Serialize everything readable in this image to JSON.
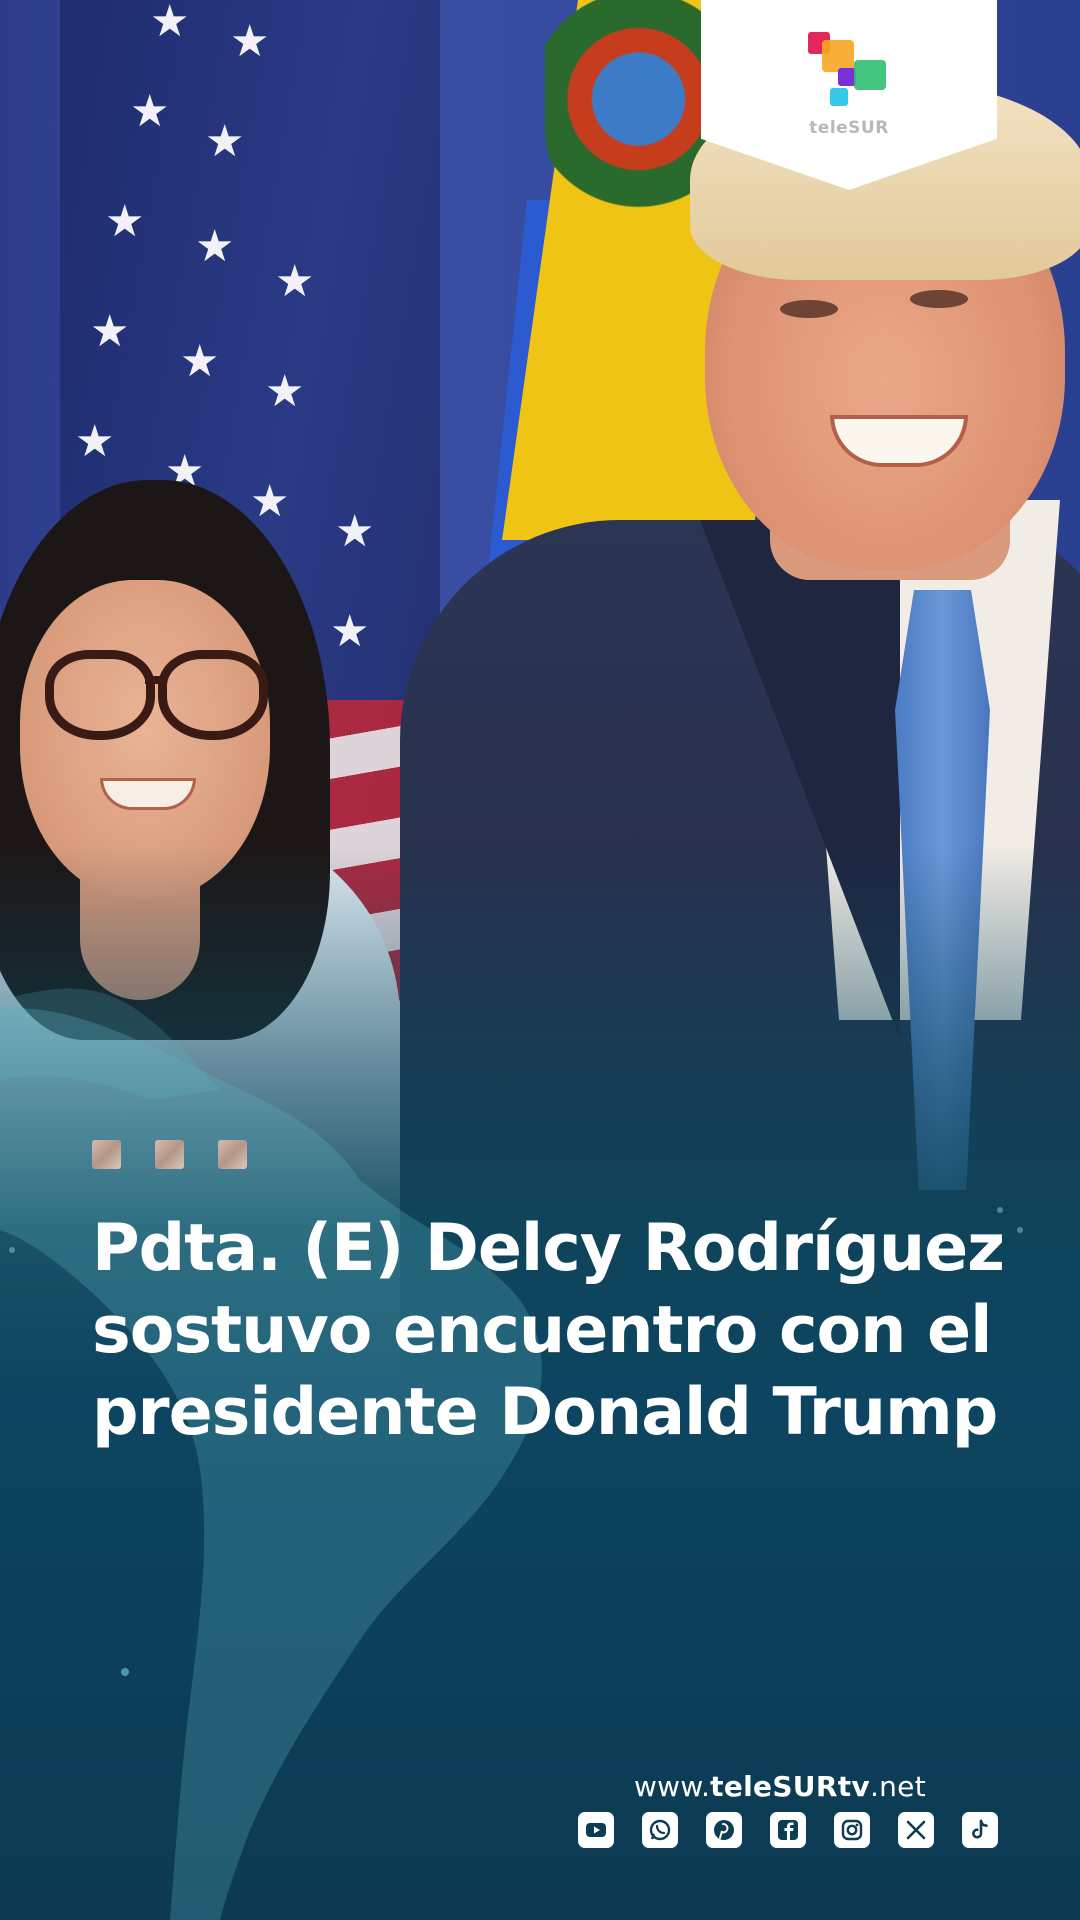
{
  "brand": {
    "name": "teleSUR",
    "colors": {
      "red": "#e0285a",
      "orange": "#f5a623",
      "purple": "#7b2fd6",
      "green": "#2fbf71",
      "cyan": "#35c8e8"
    }
  },
  "story": {
    "headline_line1": "Pdta. (E) Delcy Rodríguez",
    "headline_line2": "sostuvo encuentro con el",
    "headline_line3": "presidente Donald Trump"
  },
  "footer": {
    "url_prefix": "www.",
    "url_brand": "teleSURtv",
    "url_suffix": ".net",
    "socials": [
      {
        "icon": "youtube-icon"
      },
      {
        "icon": "whatsapp-icon"
      },
      {
        "icon": "pinterest-icon"
      },
      {
        "icon": "facebook-icon"
      },
      {
        "icon": "instagram-icon"
      },
      {
        "icon": "x-icon"
      },
      {
        "icon": "tiktok-icon"
      }
    ]
  },
  "theme": {
    "overlay": "#0d3d52",
    "text": "#ffffff"
  }
}
